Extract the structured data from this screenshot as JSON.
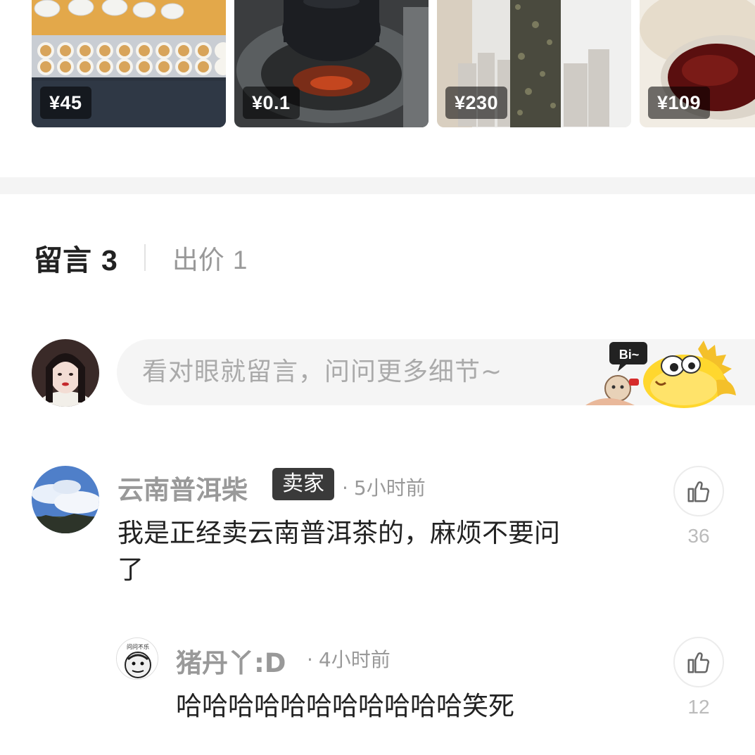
{
  "products": [
    {
      "price": "¥45",
      "icon": "tea-cups-photo"
    },
    {
      "price": "¥0.1",
      "icon": "iron-kettle-photo"
    },
    {
      "price": "¥230",
      "icon": "tea-cake-stack-photo"
    },
    {
      "price": "¥109",
      "icon": "red-tea-glass-photo"
    }
  ],
  "tabs": {
    "comments": {
      "label": "留言",
      "count": "3"
    },
    "bids": {
      "label": "出价",
      "count": "1"
    }
  },
  "input": {
    "placeholder": "看对眼就留言，问问更多细节~",
    "mascot_text": "Bi~"
  },
  "comments": [
    {
      "name": "云南普洱柴",
      "badge": "卖家",
      "time": "5小时前",
      "text_line1": "我是正经卖云南普洱茶的，麻烦不要问",
      "text_line2": "了",
      "likes": "36"
    },
    {
      "name": "猪丹丫:D",
      "avatar_text": "问问不乐",
      "time": "4小时前",
      "text": "哈哈哈哈哈哈哈哈哈哈哈笑死",
      "likes": "12"
    }
  ],
  "time_dot": "·",
  "colors": {
    "badge_bg": "#3a3a3a",
    "muted": "#999999",
    "band": "#f4f4f4"
  }
}
